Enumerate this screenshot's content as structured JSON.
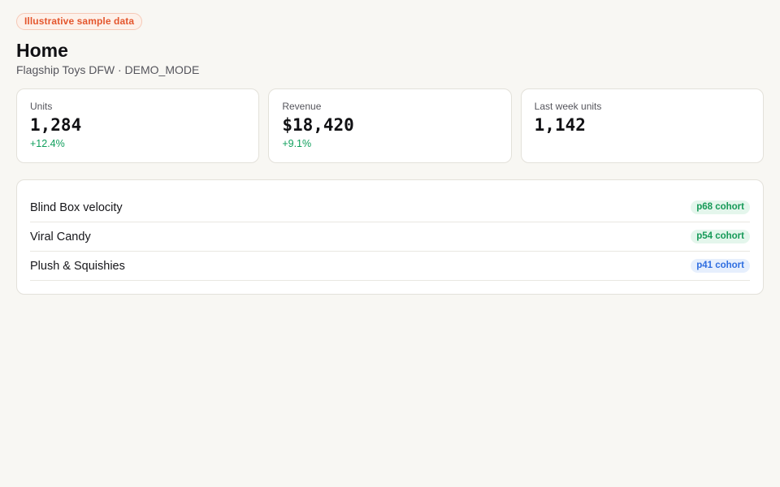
{
  "banner": {
    "label": "Illustrative sample data"
  },
  "header": {
    "title": "Home",
    "subtitle": "Flagship Toys DFW · DEMO_MODE"
  },
  "kpis": [
    {
      "label": "Units",
      "value": "1,284",
      "delta": "+12.4%"
    },
    {
      "label": "Revenue",
      "value": "$18,420",
      "delta": "+9.1%"
    },
    {
      "label": "Last week units",
      "value": "1,142",
      "delta": ""
    }
  ],
  "cohorts": [
    {
      "name": "Blind Box velocity",
      "badge": "p68 cohort",
      "tone": "green"
    },
    {
      "name": "Viral Candy",
      "badge": "p54 cohort",
      "tone": "green"
    },
    {
      "name": "Plush & Squishies",
      "badge": "p41 cohort",
      "tone": "blue"
    }
  ],
  "colors": {
    "background": "#f8f7f3",
    "banner_text": "#e4572e",
    "positive_delta": "#0f9f5c",
    "badge_green_bg": "#e4f6ec",
    "badge_green_text": "#169a58",
    "badge_blue_bg": "#e6effd",
    "badge_blue_text": "#2f6ee0"
  }
}
